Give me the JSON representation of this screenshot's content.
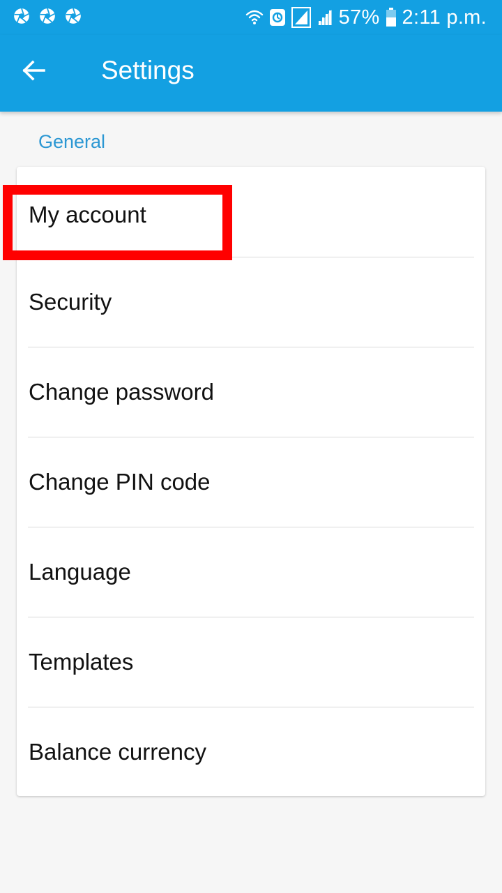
{
  "status_bar": {
    "left_icons": [
      "aperture-icon",
      "aperture-icon",
      "aperture-icon"
    ],
    "right_icons": [
      "wifi-icon",
      "data-saver-icon",
      "signal-icon",
      "signal-icon",
      "battery-icon"
    ],
    "battery": "57%",
    "time": "2:11 p.m."
  },
  "app_bar": {
    "back_icon": "arrow-left-icon",
    "title": "Settings"
  },
  "section": {
    "header": "General",
    "items": [
      {
        "label": "My account"
      },
      {
        "label": "Security"
      },
      {
        "label": "Change password"
      },
      {
        "label": "Change PIN code"
      },
      {
        "label": "Language"
      },
      {
        "label": "Templates"
      },
      {
        "label": "Balance currency"
      }
    ]
  },
  "colors": {
    "primary": "#13a0e2",
    "section_header": "#2b97d3",
    "highlight": "#ff0000",
    "background": "#f6f6f6"
  }
}
